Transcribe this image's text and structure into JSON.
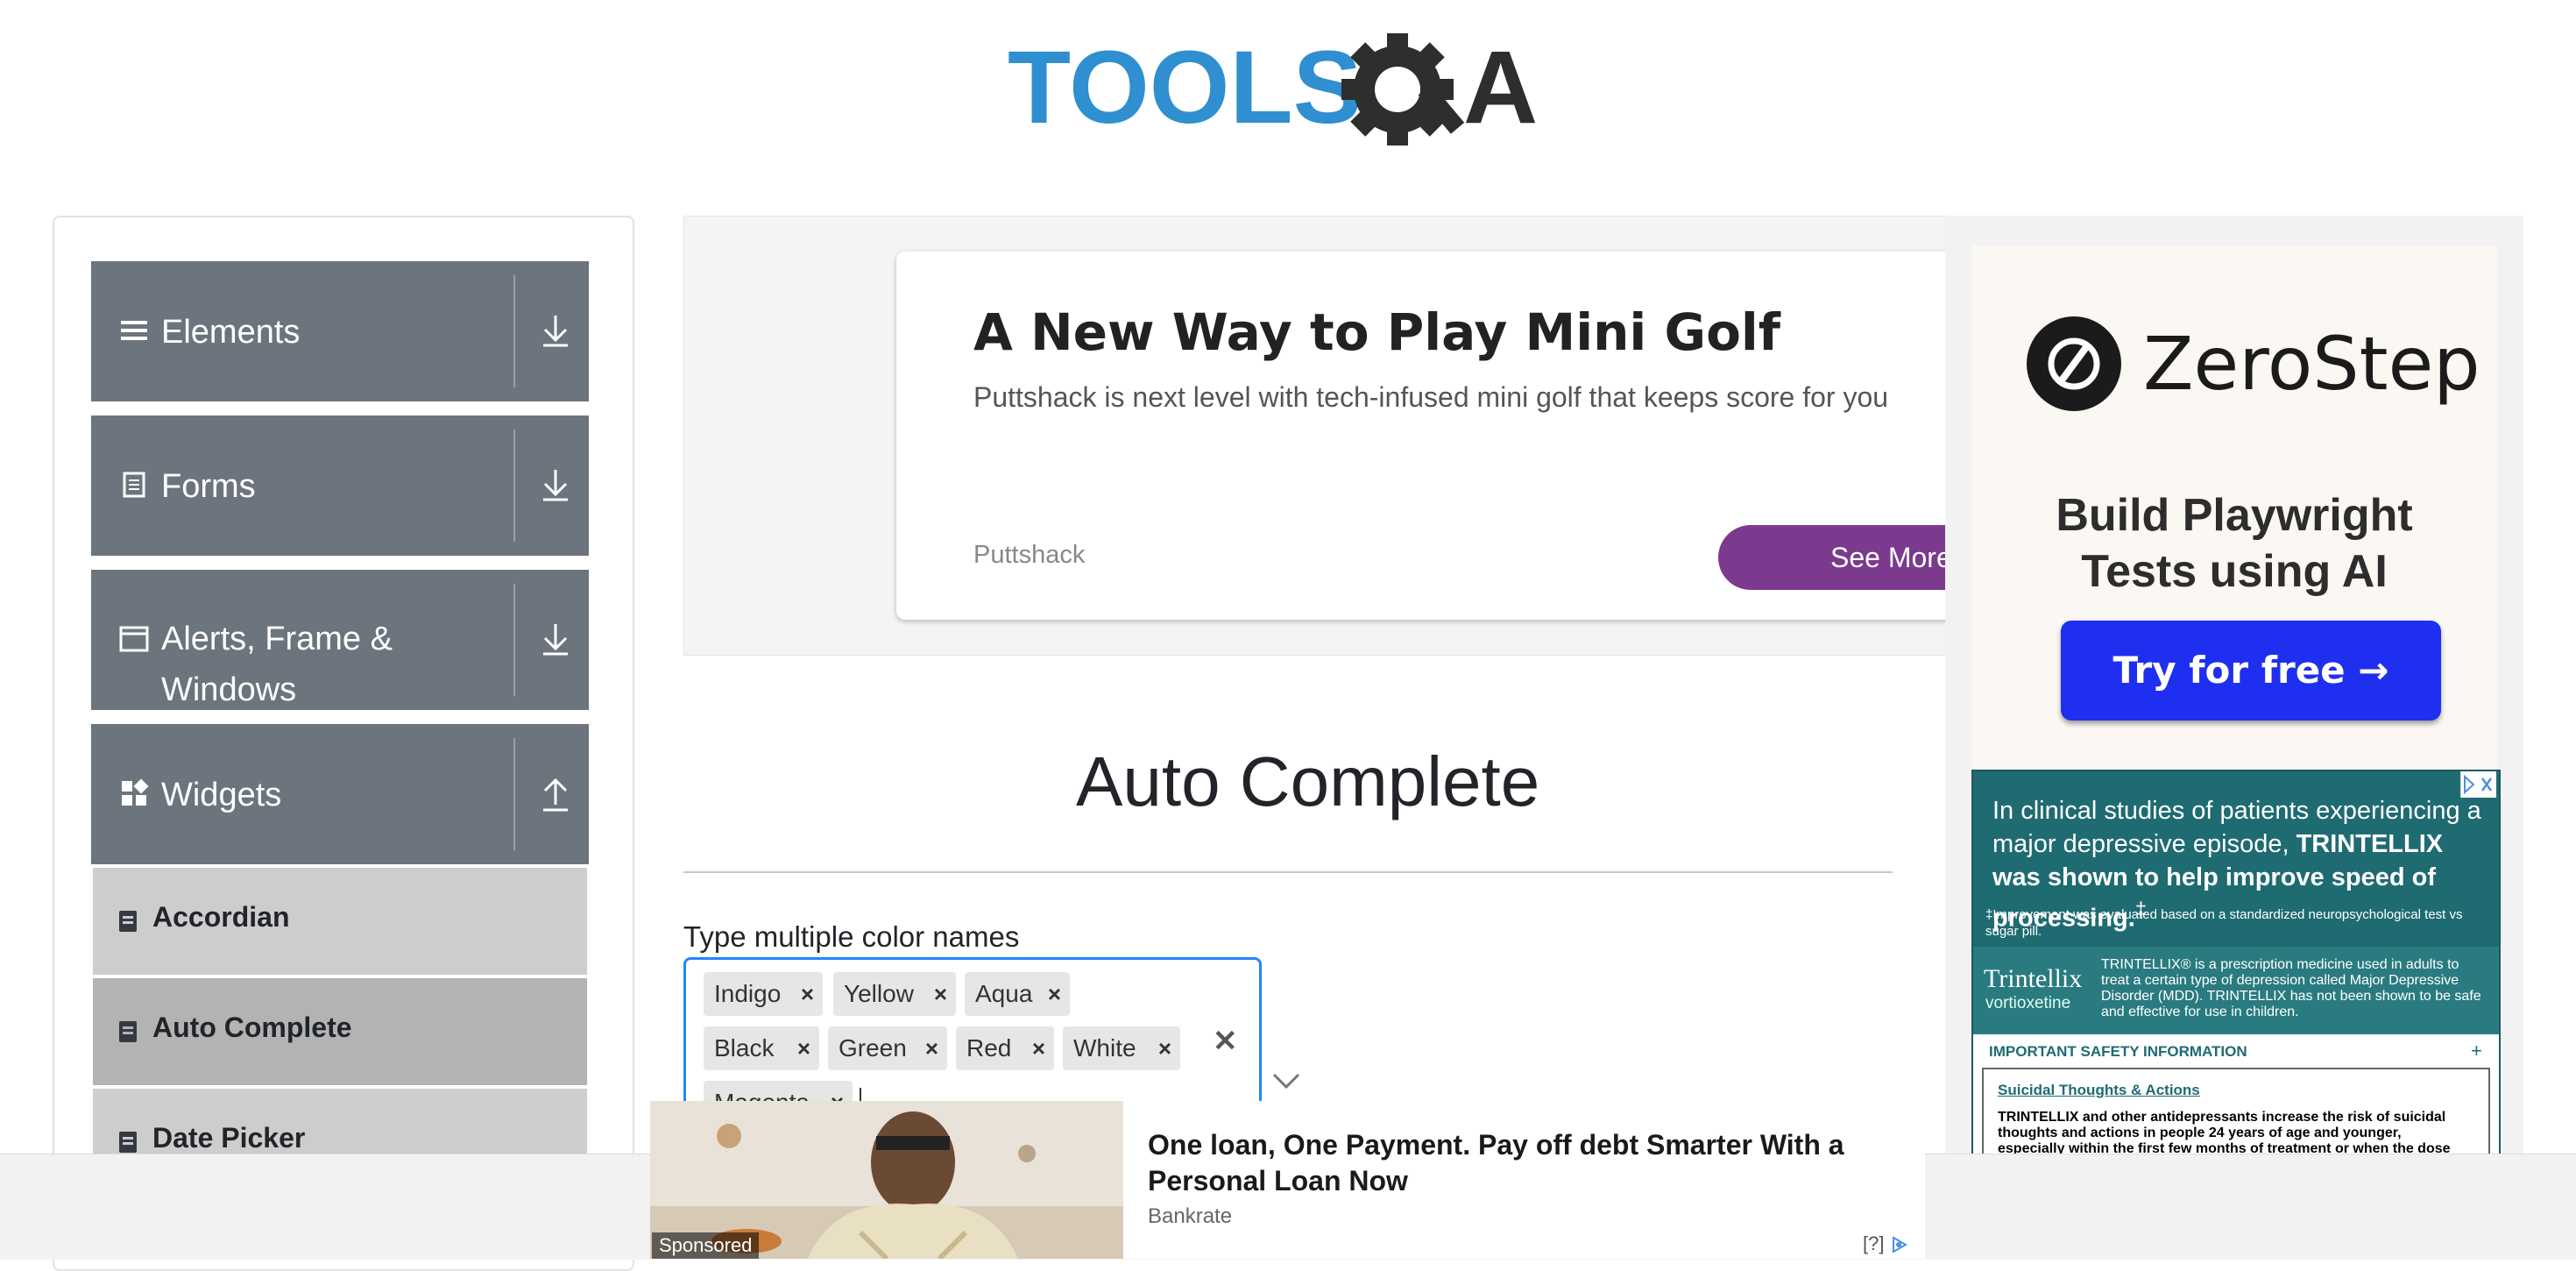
{
  "logo": {
    "text_left": "TOOLS",
    "text_right": "A"
  },
  "sidebar": {
    "groups": [
      {
        "label": "Elements"
      },
      {
        "label": "Forms"
      },
      {
        "label_line1": "Alerts, Frame &",
        "label_line2": "Windows"
      },
      {
        "label": "Widgets"
      }
    ],
    "items": [
      {
        "label": "Accordian"
      },
      {
        "label": "Auto Complete"
      },
      {
        "label": "Date Picker"
      }
    ]
  },
  "ad_card": {
    "title": "A New Way to Play Mini Golf",
    "description": "Puttshack is next level with tech-infused mini golf that keeps score for you",
    "brand": "Puttshack",
    "cta": "See More"
  },
  "right_ad": {
    "brand": "ZeroStep",
    "tagline_line1": "Build Playwright",
    "tagline_line2": "Tests using AI",
    "button": "Try for free →"
  },
  "pharma_ad": {
    "headline_pre": "In clinical studies of patients experiencing a major depressive episode, ",
    "headline_bold": "TRINTELLIX was shown to help improve speed of processing.",
    "headline_mark": "‡",
    "footnote": "‡Improvement was evaluated based on a standardized neuropsychological test vs sugar pill.",
    "brand": "Trintellix",
    "brand_sub": "vortioxetine",
    "mid_text": "TRINTELLIX® is a prescription medicine used in adults to treat a certain type of depression called Major Depressive Disorder (MDD). TRINTELLIX has not been shown to be safe and effective for use in children.",
    "isi": "IMPORTANT SAFETY INFORMATION",
    "plus": "+",
    "subhead": "Suicidal Thoughts & Actions",
    "body": "TRINTELLIX and other antidepressants increase the risk of suicidal thoughts and actions in people 24 years of age and younger, especially within the first few months of treatment or when the dose"
  },
  "main": {
    "title": "Auto Complete",
    "field_label": "Type multiple color names",
    "tags": [
      "Indigo",
      "Yellow",
      "Aqua",
      "Black",
      "Green",
      "Red",
      "White",
      "Magenta"
    ],
    "tag_remove": "×",
    "clear_all": "✕"
  },
  "bottom_ad": {
    "sponsored": "Sponsored",
    "headline": "One loan, One Payment. Pay off debt Smarter With a Personal Loan Now",
    "brand": "Bankrate",
    "adchoice": "[?]"
  },
  "colors": {
    "accent_blue": "#2684ff",
    "sidebar_group": "#6c757d",
    "cta_purple": "#7b3a8d",
    "zerostep_button": "#1f2ff0",
    "pharma_teal": "#1f6b72"
  }
}
